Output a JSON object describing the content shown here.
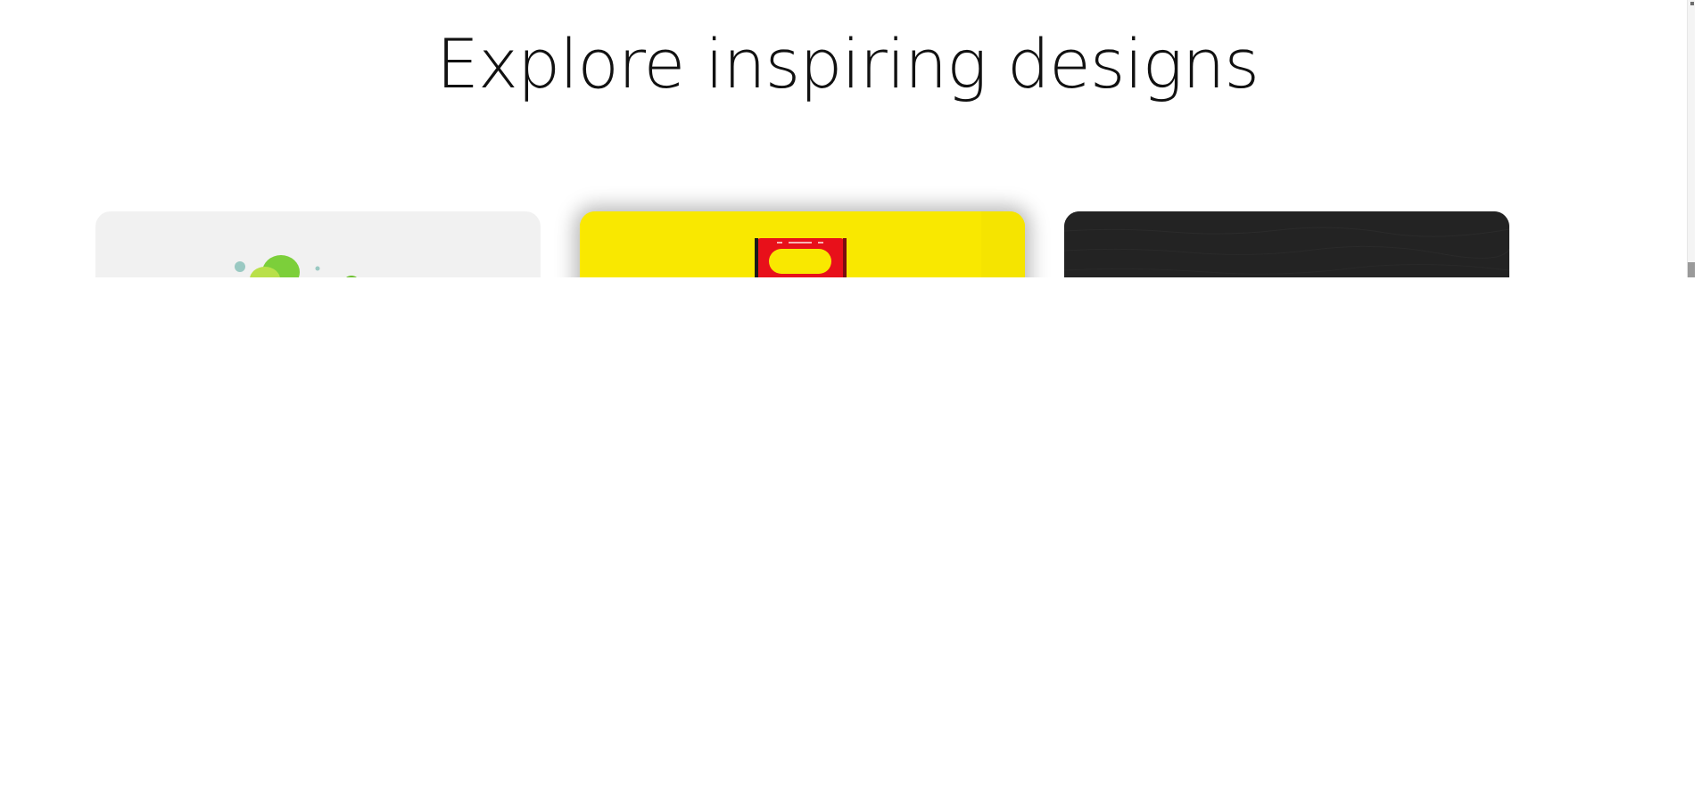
{
  "section": {
    "heading": "Explore inspiring designs"
  },
  "cards": [
    {
      "name": "design-card-green",
      "background": "#f1f1f1"
    },
    {
      "name": "design-card-yellow",
      "background": "#f9e800",
      "accent": "#e8101a"
    },
    {
      "name": "design-card-dark",
      "background": "#232323"
    }
  ],
  "colors": {
    "page_background": "#ffffff",
    "heading_text": "#111111",
    "green_accent": "#7ccf3a",
    "lime_accent": "#b9e04a",
    "teal_dot": "#9ac9c2"
  }
}
